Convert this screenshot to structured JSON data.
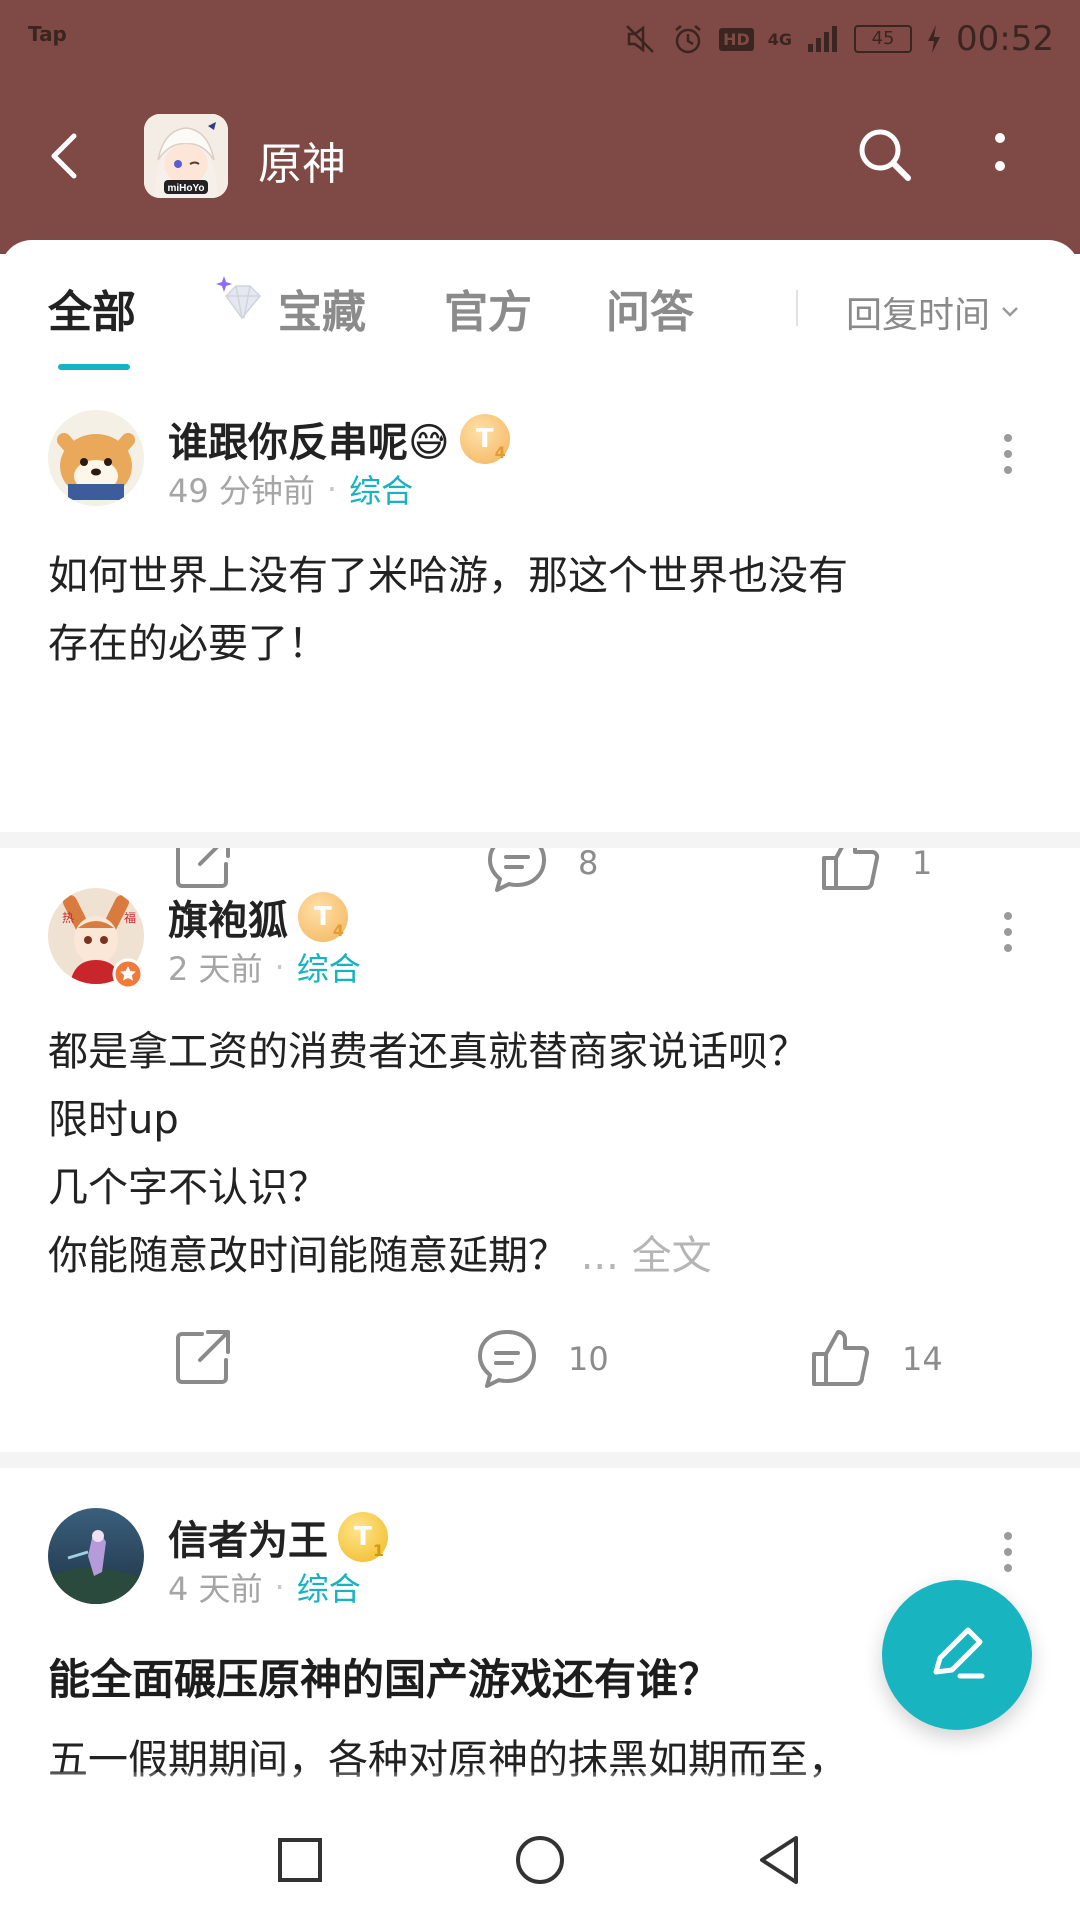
{
  "status_bar": {
    "carrier_app": "Tap",
    "network": "4G",
    "hd_label": "HD",
    "battery": "45",
    "time": "00:52"
  },
  "header": {
    "title": "原神",
    "app_icon_label": "miHoYo"
  },
  "tabs": [
    {
      "label": "全部",
      "active": true
    },
    {
      "label": "宝藏",
      "active": false
    },
    {
      "label": "官方",
      "active": false
    },
    {
      "label": "问答",
      "active": false
    }
  ],
  "sort": {
    "label": "回复时间"
  },
  "posts": [
    {
      "author": "谁跟你反串呢😅",
      "level": "T",
      "level_sub": "4",
      "time": "49 分钟前",
      "category": "综合",
      "body": "如何世界上没有了米哈游，那这个世界也没有\n存在的必要了！",
      "comments": "8",
      "likes": "1"
    },
    {
      "author": "旗袍狐",
      "level": "T",
      "level_sub": "4",
      "time": "2 天前",
      "category": "综合",
      "body": "都是拿工资的消费者还真就替商家说话呗？\n限时up\n几个字不认识？\n你能随意改时间能随意延期？",
      "more_label": "... 全文",
      "comments": "10",
      "likes": "14"
    },
    {
      "author": "信者为王",
      "level": "T",
      "level_sub": "1",
      "time": "4 天前",
      "category": "综合",
      "title": "能全面碾压原神的国产游戏还有谁？",
      "body": "五一假期期间，各种对原神的抹黑如期而至，"
    }
  ],
  "colors": {
    "header_bg": "#7f4a45",
    "accent": "#17b3c1",
    "text": "#222222",
    "muted": "#a5a5a5"
  }
}
